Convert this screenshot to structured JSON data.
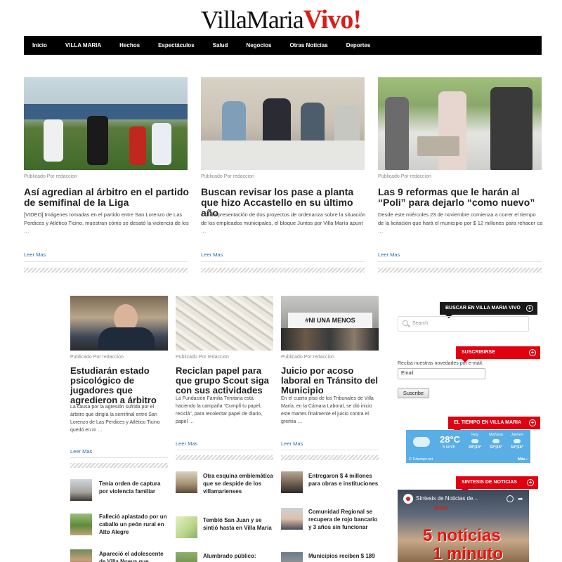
{
  "logo": {
    "part1": "VillaMaria",
    "part2": "Vivo!"
  },
  "nav": [
    "Inicio",
    "VILLA MARIA",
    "Hechos",
    "Espectáculos",
    "Salud",
    "Negocios",
    "Otras Noticias",
    "Deportes"
  ],
  "featured": [
    {
      "meta": "Publicado Por redaccion",
      "title": "Así agredian al árbitro en el partido de semifinal de la Liga",
      "excerpt": "[VIDEO] Imágenes tomadas en el partido entre San Lorenzo de Las Perdices y Atlético Ticino, muestran cómo se desató la violencia de los …",
      "read_more": "Leer Mas"
    },
    {
      "meta": "Publicado Por redaccion",
      "title": "Buscan revisar los pase a planta que hizo Accastello en su último año",
      "excerpt": "Con la presentación de dos proyectos de ordenanza sobre la situación de los empleados municipales, el bloque Juntos por Villa María apunt …",
      "read_more": "Leer Mas"
    },
    {
      "meta": "Publicado Por redaccion",
      "title": "Las 9 reformas que le harán al “Poli” para dejarlo “como nuevo”",
      "excerpt": "Desde este miércoles 23 de noviembre comienza a correr el tiempo de la licitación que hará el municipio por $ 12 millones para rehacer ca …",
      "read_more": "Leer Mas"
    }
  ],
  "secondary": [
    {
      "meta": "Publicado Por redaccion",
      "title": "Estudiarán estado psicológico de jugadores que agredieron a árbitro",
      "excerpt": "La causa por la agresión sufrida por el árbitro que dirigía la semifinal entre San Lorenzo de Las Perdices y Atlético Ticino quedó en m …",
      "read_more": "Leer Mas"
    },
    {
      "meta": "Publicado Por redaccion",
      "title": "Reciclan papel para que grupo Scout siga con sus actividades",
      "excerpt": "La Fundación Familia Trinitaria está haciendo la campaña \"Cumplí tu papel, reciclá\", para recolectar papel de diario, papel …",
      "read_more": "Leer Mas"
    },
    {
      "meta": "Publicado Por redaccion",
      "title": "Juicio por acoso laboral en Tránsito del Municipio",
      "excerpt": "En el cuarto piso de los Tribunales de Villa María, en la Cámara Laboral, se dió inicio este martes finalmente el juicio contra el gremia …",
      "read_more": "Leer Mas",
      "photo_banner": "#NI UNA MENOS"
    }
  ],
  "small_lists": [
    [
      "Tenía orden de captura por violencia familiar",
      "Falleció aplastado por un caballo un peón rural en Alto Alegre",
      "Apareció el adolescente de Villa Nueva que"
    ],
    [
      "Otra esquina emblemática que se despide de los villamarienses",
      "Tembló San Juan y se sintió hasta en Villa María",
      "Alumbrado público:"
    ],
    [
      "Entregaron $ 4 millones para obras e instituciones",
      "Comunidad Regional se recupera de rojo bancario y 3 años sin funcionar",
      "Municipios reciben $ 189"
    ]
  ],
  "sidebar": {
    "search_title": "BUSCAR EN VILLA MARIA VIVO",
    "search_placeholder": "Search",
    "subscribe_title": "SUSCRIBIRSE",
    "subscribe_text": "Reciba nuestras novedades por e-mail.",
    "email_placeholder": "Email",
    "subscribe_button": "Suscribe",
    "weather_title": "EL TIEMPO EN VILLA MARIA",
    "weather": {
      "current": "28°C",
      "wind": "5 km/h",
      "days": [
        {
          "label": "Hoy",
          "temps": "28°|19°"
        },
        {
          "label": "Mañana",
          "temps": "32°|15°"
        },
        {
          "label": "Jueves",
          "temps": "34°|16°"
        }
      ],
      "brand": "© Tutiempo.net",
      "more": "Más ›"
    },
    "news_title": "SINTESIS DE NOTICIAS",
    "video": {
      "title": "Síntesis de Noticias de...",
      "logo_text": "Vivo!",
      "overlay_line1": "5 noticias",
      "overlay_line2": "1 minuto"
    }
  },
  "colors": {
    "accent_red": "#d91e18",
    "nav_bg": "#000000",
    "link_blue": "#2a6fb0",
    "weather_blue": "#5aaee6"
  }
}
